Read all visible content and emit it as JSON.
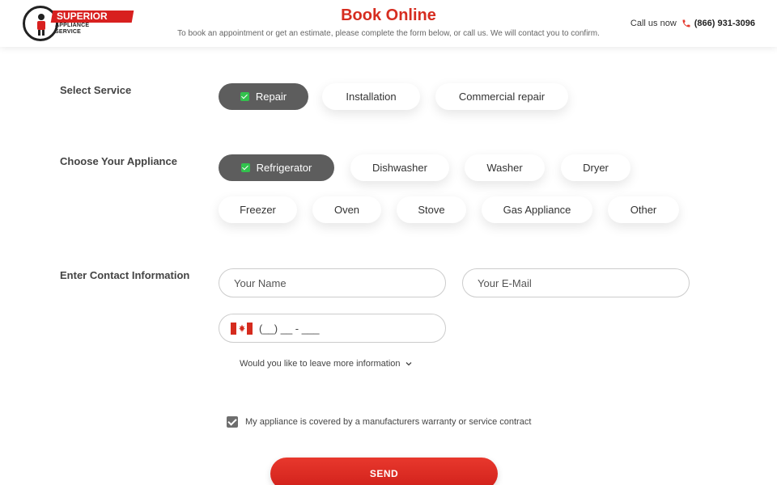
{
  "header": {
    "logo": {
      "brand": "SUPERIOR",
      "sub_line1": "APPLIANCE",
      "sub_line2": "SERVICE"
    },
    "title": "Book Online",
    "subtitle": "To book an appointment or get an estimate, please complete the form below, or call us. We will contact you to confirm.",
    "call_label": "Call us now",
    "phone_number": "(866) 931-3096"
  },
  "service": {
    "label": "Select Service",
    "options": [
      "Repair",
      "Installation",
      "Commercial repair"
    ],
    "selected": "Repair"
  },
  "appliance": {
    "label": "Choose Your Appliance",
    "options": [
      "Refrigerator",
      "Dishwasher",
      "Washer",
      "Dryer",
      "Freezer",
      "Oven",
      "Stove",
      "Gas Appliance",
      "Other"
    ],
    "selected": "Refrigerator"
  },
  "contact": {
    "label": "Enter Contact Information",
    "name_placeholder": "Your Name",
    "email_placeholder": "Your E-Mail",
    "phone_placeholder": "(__) __ - ___",
    "more_info": "Would you like to leave more information"
  },
  "warranty": {
    "label": "My appliance is covered by a manufacturers warranty or service contract",
    "checked": true
  },
  "send_label": "SEND",
  "colors": {
    "brand_red": "#d62d20",
    "selected_chip": "#5d5d5d",
    "check_green": "#32c24d"
  },
  "icons": {
    "phone": "phone-icon",
    "flag": "canada-flag-icon",
    "chevron": "chevron-down-icon"
  }
}
